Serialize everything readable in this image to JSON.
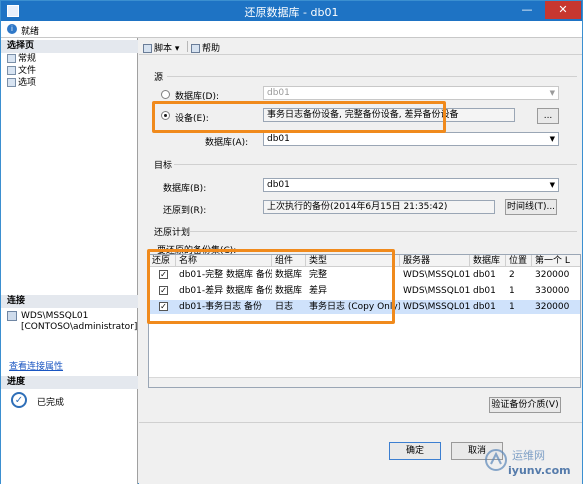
{
  "window": {
    "title": "还原数据库 - db01",
    "minimize": "—",
    "close": "✕"
  },
  "status_strip": {
    "label": "就绪"
  },
  "left": {
    "select_page_header": "选择页",
    "pages": [
      "常规",
      "文件",
      "选项"
    ],
    "connection_header": "连接",
    "server": "WDS\\MSSQL01",
    "user": "[CONTOSO\\administrator]",
    "view_connection_link": "查看连接属性",
    "progress_header": "进度",
    "progress_status": "已完成"
  },
  "toolbar": {
    "script": "脚本",
    "help": "帮助"
  },
  "source": {
    "section": "源",
    "database_option": "数据库(D):",
    "database_value": "db01",
    "device_option": "设备(E):",
    "device_value": "事务日志备份设备, 完整备份设备, 差异备份设备",
    "device_browse": "...",
    "device_database_label": "数据库(A):",
    "device_database_value": "db01"
  },
  "target": {
    "section": "目标",
    "database_label": "数据库(B):",
    "database_value": "db01",
    "restore_to_label": "还原到(R):",
    "restore_to_value": "上次执行的备份(2014年6月15日 21:35:42)",
    "timeline_button": "时间线(T)..."
  },
  "plan": {
    "section": "还原计划",
    "sets_label": "要还原的备份集(C):",
    "columns": [
      "还原",
      "名称",
      "组件",
      "类型",
      "服务器",
      "数据库",
      "位置",
      "第一个 L"
    ],
    "rows": [
      {
        "checked": true,
        "name": "db01-完整 数据库 备份",
        "component": "数据库",
        "type": "完整",
        "server": "WDS\\MSSQL01",
        "database": "db01",
        "position": "2",
        "first_lsn": "320000"
      },
      {
        "checked": true,
        "name": "db01-差异 数据库 备份",
        "component": "数据库",
        "type": "差异",
        "server": "WDS\\MSSQL01",
        "database": "db01",
        "position": "1",
        "first_lsn": "330000"
      },
      {
        "checked": true,
        "name": "db01-事务日志  备份",
        "component": "日志",
        "type": "事务日志 (Copy Only)",
        "server": "WDS\\MSSQL01",
        "database": "db01",
        "position": "1",
        "first_lsn": "320000"
      }
    ],
    "check_mark": "✓",
    "verify_button": "验证备份介质(V)"
  },
  "footer": {
    "ok": "确定",
    "cancel": "取消"
  },
  "watermark": {
    "line1": "运维网",
    "line2": "iyunv.com"
  },
  "colors": {
    "title_bar": "#1e73c4",
    "highlight": "#f08a1c",
    "selected_row": "#cfe2fb"
  }
}
